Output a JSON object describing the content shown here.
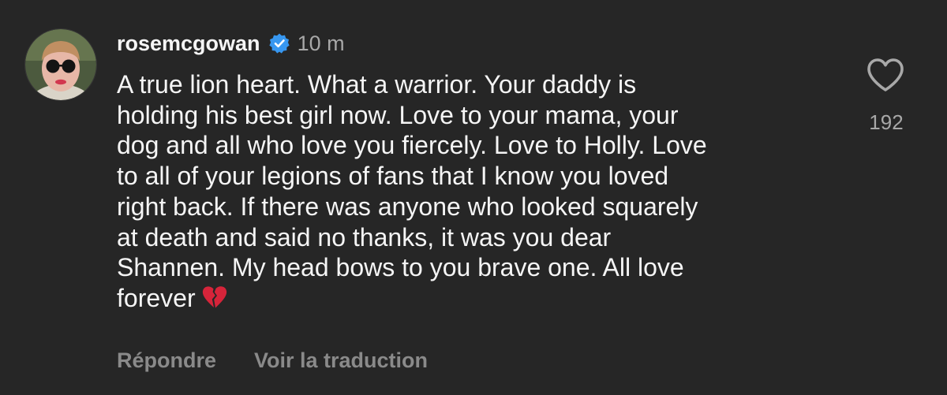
{
  "comment": {
    "username": "rosemcgowan",
    "verified": true,
    "timestamp": "10 m",
    "text": "A true lion heart. What a warrior. Your daddy is\nholding his best girl now. Love to your mama, your\ndog and all who love you fiercely. Love to Holly. Love\nto all of your legions of fans that I know you loved\nright back. If there was anyone who looked squarely\nat death and said no thanks, it was you dear\nShannen. My head bows to you brave one. All love\nforever",
    "emoji": "broken-heart",
    "like_count": "192"
  },
  "actions": {
    "reply_label": "Répondre",
    "translate_label": "Voir la traduction"
  },
  "colors": {
    "background": "#262626",
    "primary_text": "#f5f5f5",
    "secondary_text": "#a8a8a8",
    "action_text": "#8a8a8a",
    "verified_badge": "#3797f0",
    "emoji_red": "#d6243a"
  },
  "icons": {
    "verified": "verified-badge-icon",
    "like": "heart-outline-icon",
    "emoji": "broken-heart-icon"
  }
}
